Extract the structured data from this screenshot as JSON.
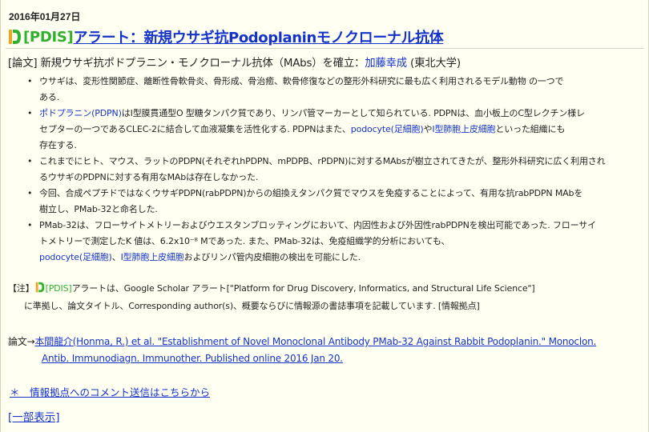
{
  "post": {
    "date": "2016年01月27日",
    "tag": "[PDIS]",
    "title": "アラート：新規ウサギ抗Podoplaninモノクローナル抗体"
  },
  "summary": {
    "prefix": "[論文] 新規ウサギ抗ポドプラニン・モノクローナル抗体（MAbs）を確立：",
    "author": "加藤幸成",
    "affiliation": " (東北大学)"
  },
  "bullets": [
    {
      "lines": [
        [
          {
            "t": "ウサギは、変形性関節症、離断性骨軟骨炎、骨形成、骨治癒、軟骨修復などの整形外科研究に最も広く利用されるモデル動物 の一つで"
          }
        ],
        [
          {
            "t": "ある."
          }
        ]
      ]
    },
    {
      "lines": [
        [
          {
            "t": "ポドプラニン(PDPN)",
            "link": true
          },
          {
            "t": "はI型膜貫通型O 型糖タンパク質であり、リンパ管マーカーとして知られている. PDPNは、血小板上のC型レクチン様レ"
          }
        ],
        [
          {
            "t": "セプターの一つであるCLEC-2に結合して血液凝集を活性化する. PDPNはまた、"
          },
          {
            "t": "podocyte(足細胞)",
            "link": true
          },
          {
            "t": "や"
          },
          {
            "t": "I型肺胞上皮細胞",
            "link": true
          },
          {
            "t": "といった組織にも"
          }
        ],
        [
          {
            "t": "存在する."
          }
        ]
      ]
    },
    {
      "lines": [
        [
          {
            "t": "これまでにヒト、マウス、ラットのPDPN(それぞれhPDPN、mPDPB、rPDPN)に対するMAbsが樹立されてきたが、整形外科研究に広く利用され"
          }
        ],
        [
          {
            "t": "るウサギのPDPNに対する有用なMAbは存在しなかった."
          }
        ]
      ]
    },
    {
      "lines": [
        [
          {
            "t": "今回、合成ペプチドではなくウサギPDPN(rabPDPN)からの組換えタンパク質でマウスを免疫することによって、有用な抗rabPDPN MAbを"
          }
        ],
        [
          {
            "t": "樹立し、PMab-32と命名した."
          }
        ]
      ]
    },
    {
      "lines": [
        [
          {
            "t": "PMab-32は、フローサイトメトリーおよびウエスタンブロッティングにおいて、内因性および外因性rabPDPNを検出可能であった. フローサイ"
          }
        ],
        [
          {
            "t": "トメトリーで測定したK 値は、6.2x10⁻⁸ Mであった. また、PMab-32は、免疫組織学的分析においても、"
          }
        ],
        [
          {
            "t": "podocyte(足細胞)",
            "link": true
          },
          {
            "t": "、"
          },
          {
            "t": "I型肺胞上皮細胞",
            "link": true
          },
          {
            "t": "およびリンパ管内皮細胞の検出を可能にした."
          }
        ]
      ]
    }
  ],
  "note": {
    "prefix": "【注】",
    "tag": "[PDIS]",
    "line1_rest": "アラートは、Google Scholar アラート[\"Platform for Drug Discovery, Informatics, and Structural Life Science\"]",
    "line2": "に準拠し、論文タイトル、Corresponding author(s)、概要ならびに情報源の書誌事項を記載しています. [情報拠点]"
  },
  "reference": {
    "prefix": "論文→",
    "line1_link": "本間龍介(Honma, R.) et al. \"Establishment of Novel Monoclonal Antibody PMab-32 Against Rabbit Podoplanin.\" Monoclon.",
    "line2_link": "Antib. Immunodiagn. Immunother. Published online 2016 Jan 20."
  },
  "links": {
    "comment": "＊　情報拠点へのコメント送信はこちらから",
    "partial": "[一部表示]"
  },
  "colors": {
    "link": "#1533c9",
    "tag_green": "#2fb12f",
    "background": "#fffff2"
  }
}
